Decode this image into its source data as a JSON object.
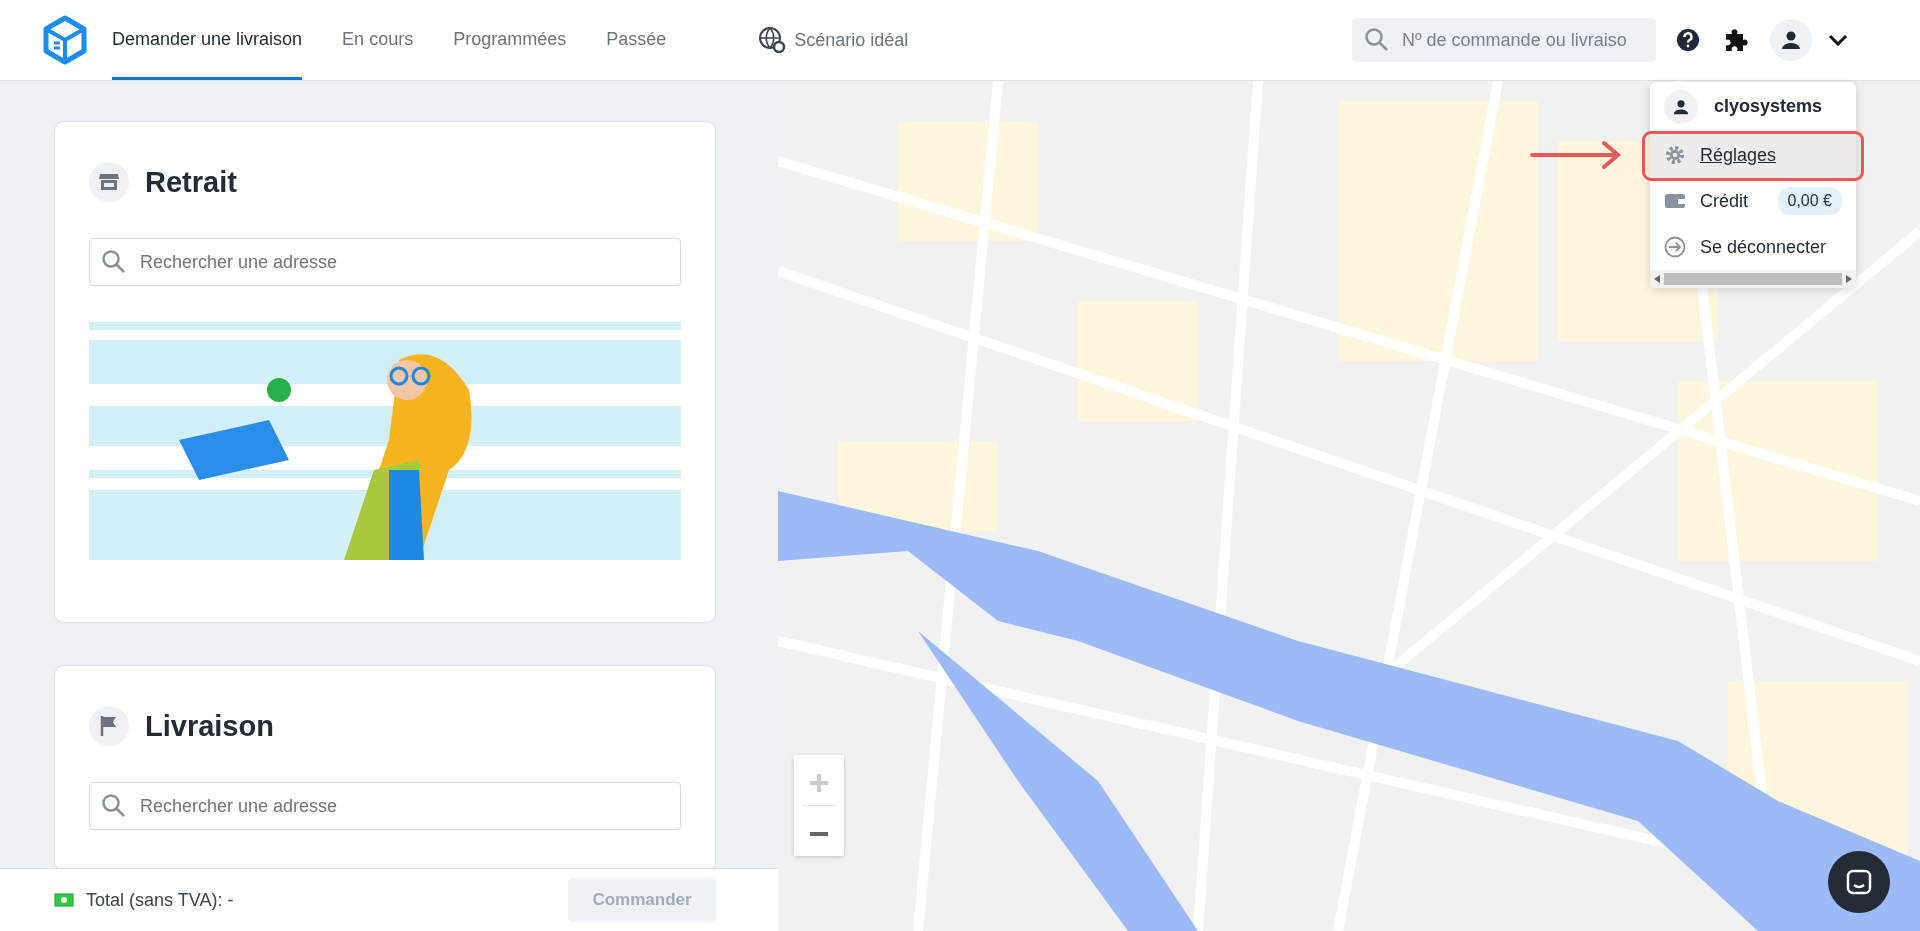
{
  "nav": {
    "tabs": [
      {
        "label": "Demander une livraison",
        "selected": true
      },
      {
        "label": "En cours",
        "selected": false
      },
      {
        "label": "Programmées",
        "selected": false
      },
      {
        "label": "Passée",
        "selected": false
      }
    ],
    "scenario_link": "Scénario idéal"
  },
  "search": {
    "placeholder": "Nº de commande ou livraiso"
  },
  "user_menu": {
    "username": "clyosystems",
    "items": [
      {
        "kind": "settings",
        "label": "Réglages",
        "selected": true
      },
      {
        "kind": "credit",
        "label": "Crédit",
        "badge": "0,00 €",
        "selected": false
      },
      {
        "kind": "logout",
        "label": "Se déconnecter",
        "selected": false
      }
    ]
  },
  "pickup": {
    "title": "Retrait",
    "search_placeholder": "Rechercher une adresse"
  },
  "delivery": {
    "title": "Livraison",
    "search_placeholder": "Rechercher une adresse"
  },
  "footer": {
    "total": "Total (sans TVA): -",
    "order_button": "Commander",
    "order_disabled": true
  },
  "map": {
    "zoom_in_disabled": true
  }
}
